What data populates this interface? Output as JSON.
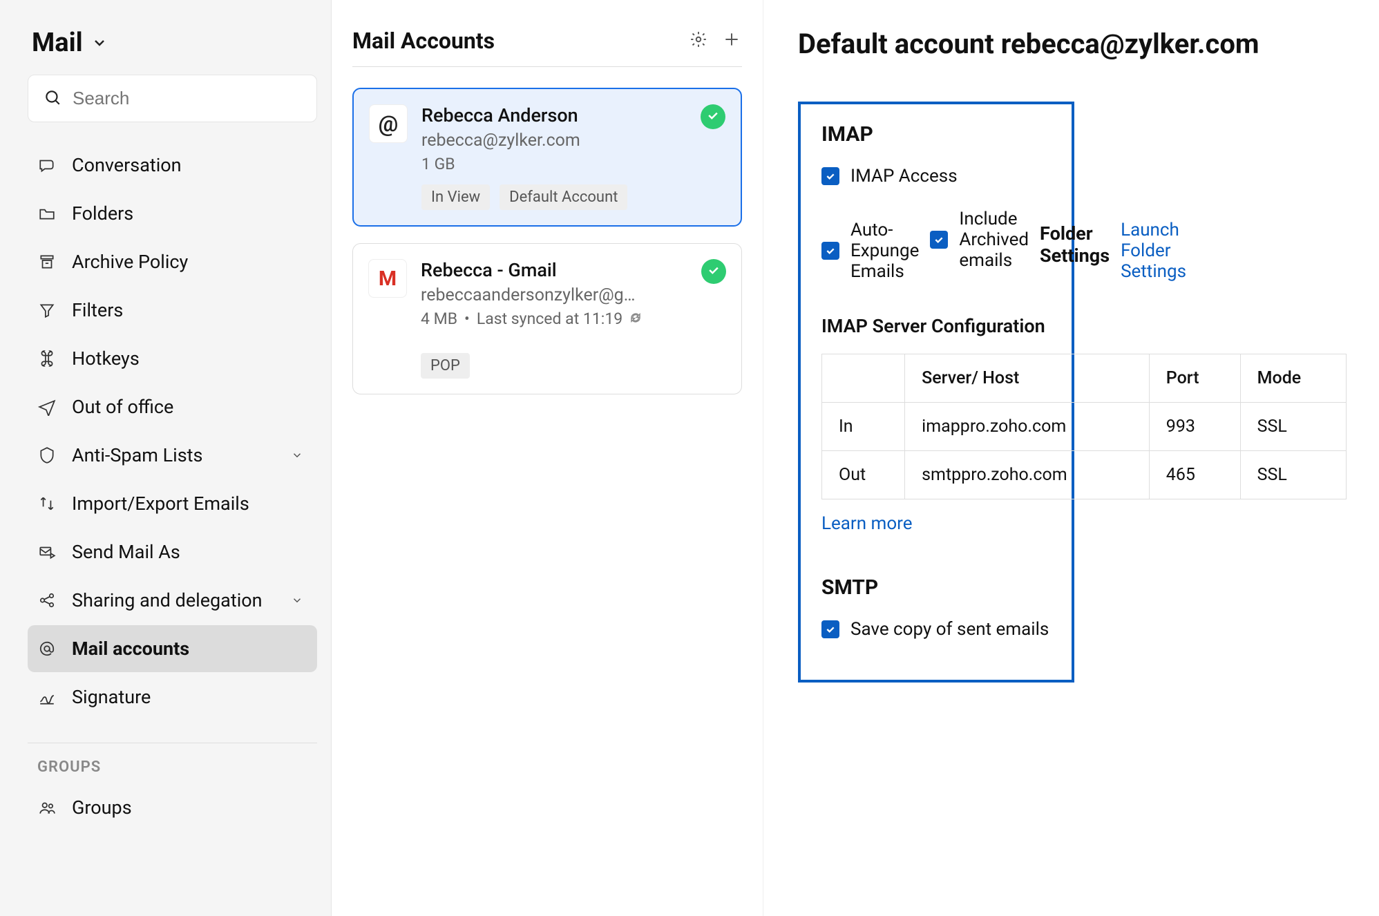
{
  "sidebar": {
    "title": "Mail",
    "search_placeholder": "Search",
    "items": [
      {
        "label": "Conversation"
      },
      {
        "label": "Folders"
      },
      {
        "label": "Archive Policy"
      },
      {
        "label": "Filters"
      },
      {
        "label": "Hotkeys"
      },
      {
        "label": "Out of office"
      },
      {
        "label": "Anti-Spam Lists",
        "expandable": true
      },
      {
        "label": "Import/Export Emails"
      },
      {
        "label": "Send Mail As"
      },
      {
        "label": "Sharing and delegation",
        "expandable": true
      },
      {
        "label": "Mail accounts",
        "active": true
      },
      {
        "label": "Signature"
      }
    ],
    "groups_label": "GROUPS",
    "groups_item": "Groups"
  },
  "middle": {
    "title": "Mail Accounts",
    "accounts": [
      {
        "name": "Rebecca Anderson",
        "email": "rebecca@zylker.com",
        "size": "1 GB",
        "tags": [
          "In View",
          "Default Account"
        ],
        "selected": true,
        "type": "at"
      },
      {
        "name": "Rebecca - Gmail",
        "email": "rebeccaandersonzylker@g…",
        "size": "4 MB",
        "sync": "Last synced at 11:19",
        "tags": [
          "POP"
        ],
        "type": "gmail"
      }
    ]
  },
  "detail": {
    "title": "Default account rebecca@zylker.com",
    "imap": {
      "heading": "IMAP",
      "access": "IMAP Access",
      "expunge": "Auto-Expunge Emails",
      "archived": "Include Archived emails",
      "folder_h": "Folder Settings",
      "launch": "Launch Folder Settings"
    },
    "server": {
      "heading": "IMAP Server Configuration",
      "cols": [
        "",
        "Server/ Host",
        "Port",
        "Mode"
      ],
      "rows": [
        {
          "dir": "In",
          "host": "imappro.zoho.com",
          "port": "993",
          "mode": "SSL"
        },
        {
          "dir": "Out",
          "host": "smtppro.zoho.com",
          "port": "465",
          "mode": "SSL"
        }
      ],
      "learn": "Learn more"
    },
    "smtp": {
      "heading": "SMTP",
      "save_copy": "Save copy of sent emails"
    }
  }
}
